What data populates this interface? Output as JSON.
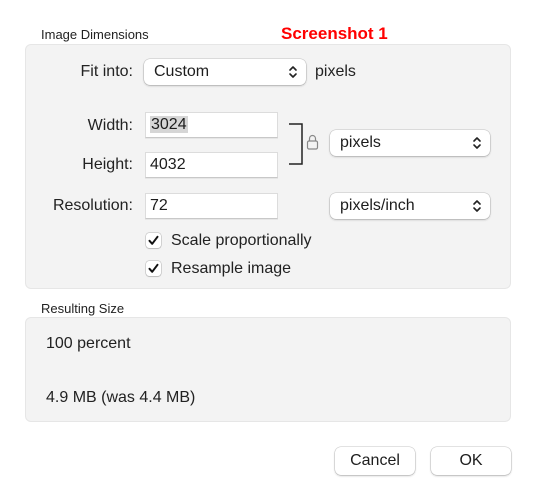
{
  "annotation": "Screenshot 1",
  "image_dimensions": {
    "section_label": "Image Dimensions",
    "fit_into": {
      "label": "Fit into:",
      "value": "Custom",
      "unit_label": "pixels"
    },
    "width": {
      "label": "Width:",
      "value": "3024",
      "selected": true
    },
    "height": {
      "label": "Height:",
      "value": "4032"
    },
    "size_unit": {
      "value": "pixels"
    },
    "lock_icon": "lock-icon",
    "resolution": {
      "label": "Resolution:",
      "value": "72",
      "unit": "pixels/inch"
    },
    "scale_proportionally": {
      "label": "Scale proportionally",
      "checked": true
    },
    "resample_image": {
      "label": "Resample image",
      "checked": true
    }
  },
  "resulting_size": {
    "section_label": "Resulting Size",
    "percent": "100 percent",
    "file_size": "4.9 MB (was 4.4 MB)"
  },
  "buttons": {
    "cancel": "Cancel",
    "ok": "OK"
  },
  "colors": {
    "annotation": "#ff0000",
    "panel_bg": "#f3f3f3",
    "selection": "#d6d6d6"
  }
}
